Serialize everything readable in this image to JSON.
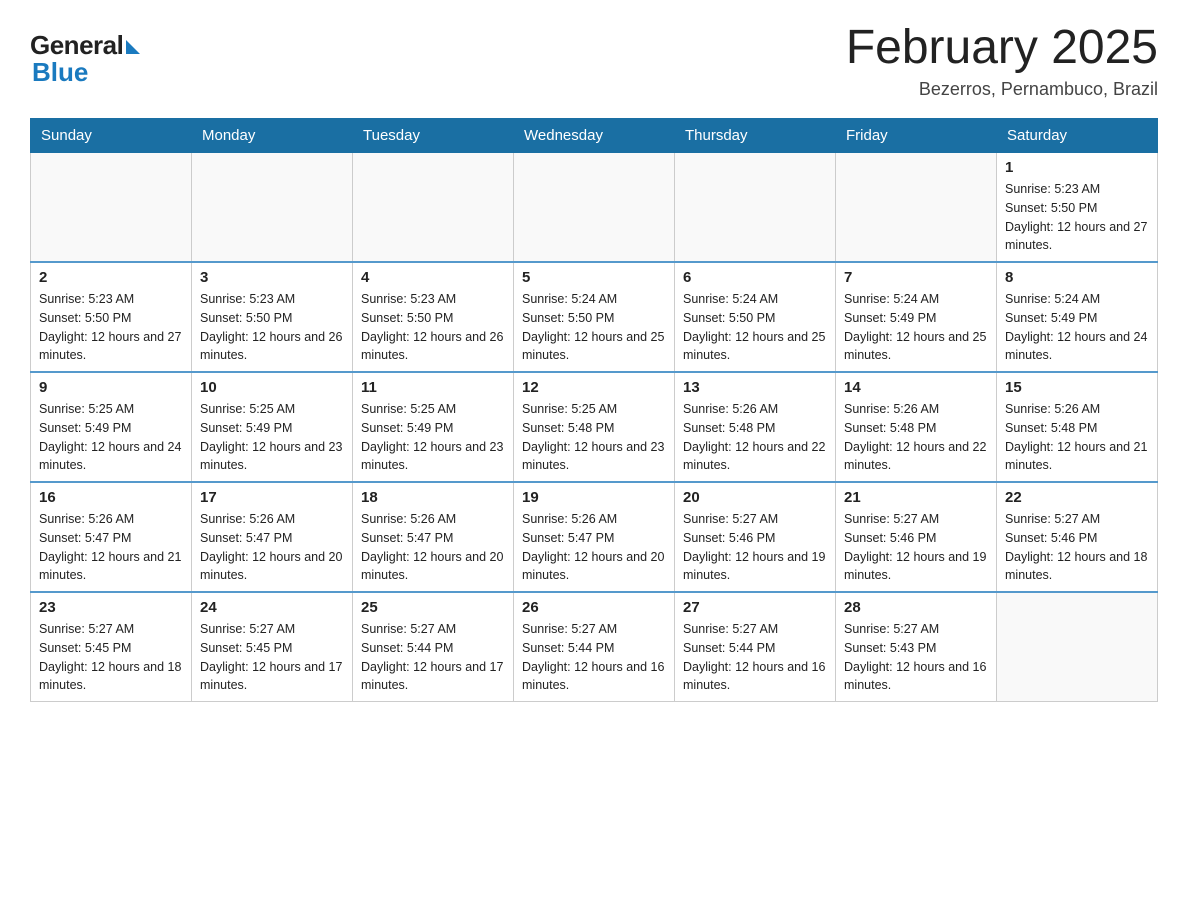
{
  "header": {
    "logo": {
      "general": "General",
      "blue": "Blue"
    },
    "title": "February 2025",
    "location": "Bezerros, Pernambuco, Brazil"
  },
  "weekdays": [
    "Sunday",
    "Monday",
    "Tuesday",
    "Wednesday",
    "Thursday",
    "Friday",
    "Saturday"
  ],
  "weeks": [
    [
      {
        "day": "",
        "info": ""
      },
      {
        "day": "",
        "info": ""
      },
      {
        "day": "",
        "info": ""
      },
      {
        "day": "",
        "info": ""
      },
      {
        "day": "",
        "info": ""
      },
      {
        "day": "",
        "info": ""
      },
      {
        "day": "1",
        "info": "Sunrise: 5:23 AM\nSunset: 5:50 PM\nDaylight: 12 hours and 27 minutes."
      }
    ],
    [
      {
        "day": "2",
        "info": "Sunrise: 5:23 AM\nSunset: 5:50 PM\nDaylight: 12 hours and 27 minutes."
      },
      {
        "day": "3",
        "info": "Sunrise: 5:23 AM\nSunset: 5:50 PM\nDaylight: 12 hours and 26 minutes."
      },
      {
        "day": "4",
        "info": "Sunrise: 5:23 AM\nSunset: 5:50 PM\nDaylight: 12 hours and 26 minutes."
      },
      {
        "day": "5",
        "info": "Sunrise: 5:24 AM\nSunset: 5:50 PM\nDaylight: 12 hours and 25 minutes."
      },
      {
        "day": "6",
        "info": "Sunrise: 5:24 AM\nSunset: 5:50 PM\nDaylight: 12 hours and 25 minutes."
      },
      {
        "day": "7",
        "info": "Sunrise: 5:24 AM\nSunset: 5:49 PM\nDaylight: 12 hours and 25 minutes."
      },
      {
        "day": "8",
        "info": "Sunrise: 5:24 AM\nSunset: 5:49 PM\nDaylight: 12 hours and 24 minutes."
      }
    ],
    [
      {
        "day": "9",
        "info": "Sunrise: 5:25 AM\nSunset: 5:49 PM\nDaylight: 12 hours and 24 minutes."
      },
      {
        "day": "10",
        "info": "Sunrise: 5:25 AM\nSunset: 5:49 PM\nDaylight: 12 hours and 23 minutes."
      },
      {
        "day": "11",
        "info": "Sunrise: 5:25 AM\nSunset: 5:49 PM\nDaylight: 12 hours and 23 minutes."
      },
      {
        "day": "12",
        "info": "Sunrise: 5:25 AM\nSunset: 5:48 PM\nDaylight: 12 hours and 23 minutes."
      },
      {
        "day": "13",
        "info": "Sunrise: 5:26 AM\nSunset: 5:48 PM\nDaylight: 12 hours and 22 minutes."
      },
      {
        "day": "14",
        "info": "Sunrise: 5:26 AM\nSunset: 5:48 PM\nDaylight: 12 hours and 22 minutes."
      },
      {
        "day": "15",
        "info": "Sunrise: 5:26 AM\nSunset: 5:48 PM\nDaylight: 12 hours and 21 minutes."
      }
    ],
    [
      {
        "day": "16",
        "info": "Sunrise: 5:26 AM\nSunset: 5:47 PM\nDaylight: 12 hours and 21 minutes."
      },
      {
        "day": "17",
        "info": "Sunrise: 5:26 AM\nSunset: 5:47 PM\nDaylight: 12 hours and 20 minutes."
      },
      {
        "day": "18",
        "info": "Sunrise: 5:26 AM\nSunset: 5:47 PM\nDaylight: 12 hours and 20 minutes."
      },
      {
        "day": "19",
        "info": "Sunrise: 5:26 AM\nSunset: 5:47 PM\nDaylight: 12 hours and 20 minutes."
      },
      {
        "day": "20",
        "info": "Sunrise: 5:27 AM\nSunset: 5:46 PM\nDaylight: 12 hours and 19 minutes."
      },
      {
        "day": "21",
        "info": "Sunrise: 5:27 AM\nSunset: 5:46 PM\nDaylight: 12 hours and 19 minutes."
      },
      {
        "day": "22",
        "info": "Sunrise: 5:27 AM\nSunset: 5:46 PM\nDaylight: 12 hours and 18 minutes."
      }
    ],
    [
      {
        "day": "23",
        "info": "Sunrise: 5:27 AM\nSunset: 5:45 PM\nDaylight: 12 hours and 18 minutes."
      },
      {
        "day": "24",
        "info": "Sunrise: 5:27 AM\nSunset: 5:45 PM\nDaylight: 12 hours and 17 minutes."
      },
      {
        "day": "25",
        "info": "Sunrise: 5:27 AM\nSunset: 5:44 PM\nDaylight: 12 hours and 17 minutes."
      },
      {
        "day": "26",
        "info": "Sunrise: 5:27 AM\nSunset: 5:44 PM\nDaylight: 12 hours and 16 minutes."
      },
      {
        "day": "27",
        "info": "Sunrise: 5:27 AM\nSunset: 5:44 PM\nDaylight: 12 hours and 16 minutes."
      },
      {
        "day": "28",
        "info": "Sunrise: 5:27 AM\nSunset: 5:43 PM\nDaylight: 12 hours and 16 minutes."
      },
      {
        "day": "",
        "info": ""
      }
    ]
  ]
}
